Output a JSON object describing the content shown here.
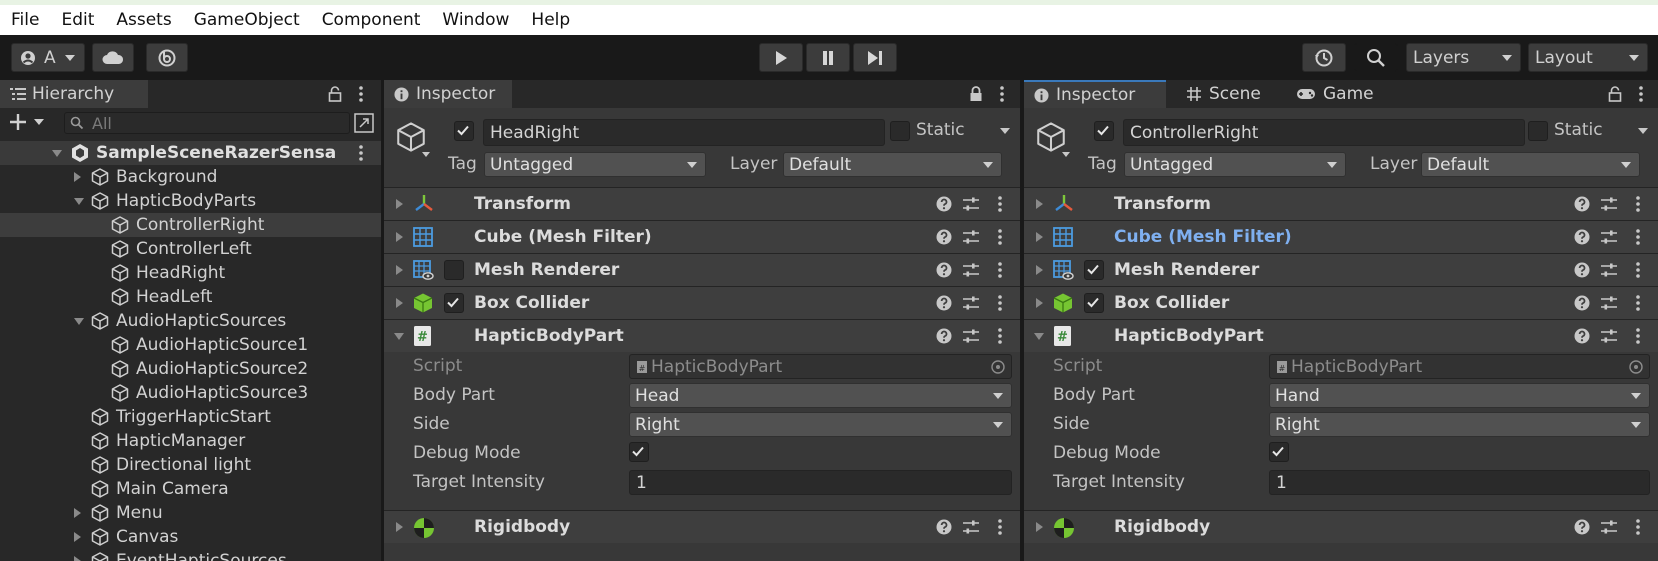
{
  "menu": [
    "File",
    "Edit",
    "Assets",
    "GameObject",
    "Component",
    "Window",
    "Help"
  ],
  "toolbar": {
    "account_label": "A",
    "layers_label": "Layers",
    "layout_label": "Layout"
  },
  "hierarchy": {
    "tab_label": "Hierarchy",
    "search_placeholder": "All",
    "scene_name": "SampleSceneRazerSensa",
    "items": [
      {
        "label": "Background",
        "depth": 1,
        "arrow": "right"
      },
      {
        "label": "HapticBodyParts",
        "depth": 1,
        "arrow": "down"
      },
      {
        "label": "ControllerRight",
        "depth": 2,
        "arrow": "",
        "selected": true
      },
      {
        "label": "ControllerLeft",
        "depth": 2,
        "arrow": ""
      },
      {
        "label": "HeadRight",
        "depth": 2,
        "arrow": ""
      },
      {
        "label": "HeadLeft",
        "depth": 2,
        "arrow": ""
      },
      {
        "label": "AudioHapticSources",
        "depth": 1,
        "arrow": "down"
      },
      {
        "label": "AudioHapticSource1",
        "depth": 2,
        "arrow": ""
      },
      {
        "label": "AudioHapticSource2",
        "depth": 2,
        "arrow": ""
      },
      {
        "label": "AudioHapticSource3",
        "depth": 2,
        "arrow": ""
      },
      {
        "label": "TriggerHapticStart",
        "depth": 1,
        "arrow": ""
      },
      {
        "label": "HapticManager",
        "depth": 1,
        "arrow": ""
      },
      {
        "label": "Directional light",
        "depth": 1,
        "arrow": ""
      },
      {
        "label": "Main Camera",
        "depth": 1,
        "arrow": ""
      },
      {
        "label": "Menu",
        "depth": 1,
        "arrow": "right"
      },
      {
        "label": "Canvas",
        "depth": 1,
        "arrow": "right"
      },
      {
        "label": "EventHapticSources",
        "depth": 1,
        "arrow": "right"
      }
    ]
  },
  "inspector_left": {
    "tab_label": "Inspector",
    "object_name": "HeadRight",
    "static_label": "Static",
    "tag_label": "Tag",
    "tag_value": "Untagged",
    "layer_label": "Layer",
    "layer_value": "Default",
    "components": {
      "transform": "Transform",
      "mesh_filter": "Cube (Mesh Filter)",
      "mesh_renderer": "Mesh Renderer",
      "box_collider": "Box Collider",
      "haptic": "HapticBodyPart",
      "rigidbody": "Rigidbody"
    },
    "fields": {
      "script_label": "Script",
      "script_value": "HapticBodyPart",
      "body_part_label": "Body Part",
      "body_part_value": "Head",
      "side_label": "Side",
      "side_value": "Right",
      "debug_label": "Debug Mode",
      "intensity_label": "Target Intensity",
      "intensity_value": "1"
    }
  },
  "inspector_right": {
    "tabs": [
      "Inspector",
      "Scene",
      "Game"
    ],
    "object_name": "ControllerRight",
    "static_label": "Static",
    "tag_label": "Tag",
    "tag_value": "Untagged",
    "layer_label": "Layer",
    "layer_value": "Default",
    "components": {
      "transform": "Transform",
      "mesh_filter": "Cube (Mesh Filter)",
      "mesh_renderer": "Mesh Renderer",
      "box_collider": "Box Collider",
      "haptic": "HapticBodyPart",
      "rigidbody": "Rigidbody"
    },
    "fields": {
      "script_label": "Script",
      "script_value": "HapticBodyPart",
      "body_part_label": "Body Part",
      "body_part_value": "Hand",
      "side_label": "Side",
      "side_value": "Right",
      "debug_label": "Debug Mode",
      "intensity_label": "Target Intensity",
      "intensity_value": "1"
    }
  },
  "colors": {
    "accent_blue": "#3a79bb",
    "modified_text": "#7fb0f0",
    "selection": "#3d3d3d"
  }
}
